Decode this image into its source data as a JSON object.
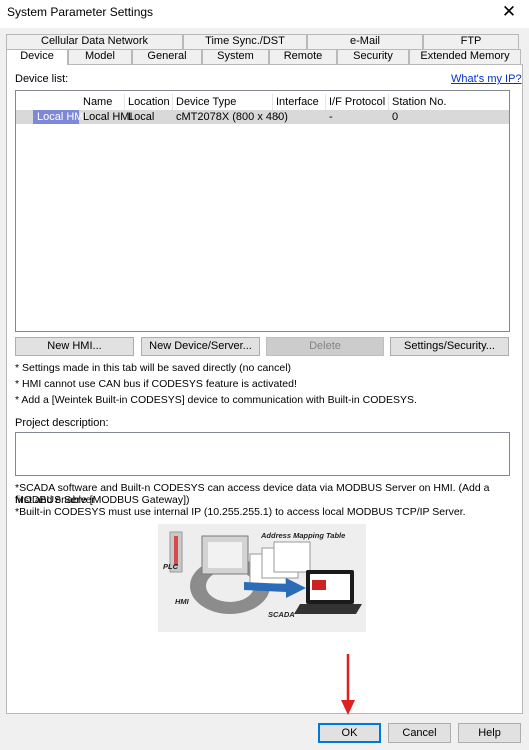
{
  "window": {
    "title": "System Parameter Settings",
    "close_glyph": "✕"
  },
  "tabs_row1": [
    "Cellular Data Network",
    "Time Sync./DST",
    "e-Mail",
    "FTP"
  ],
  "tabs_row2": [
    "Device",
    "Model",
    "General",
    "System",
    "Remote",
    "Security",
    "Extended Memory"
  ],
  "device_panel": {
    "list_label": "Device list:",
    "whats_my_ip": "What's my IP?",
    "columns": [
      "Name",
      "Location",
      "Device Type",
      "Interface",
      "I/F Protocol",
      "Station No."
    ],
    "rows": [
      {
        "tag": "Local HMI",
        "name": "Local HMI",
        "location": "Local",
        "device_type": "cMT2078X (800 x 480)",
        "interface": "-",
        "protocol": "-",
        "station": "0"
      }
    ],
    "buttons": {
      "new_hmi": "New HMI...",
      "new_device": "New Device/Server...",
      "delete": "Delete",
      "settings": "Settings/Security..."
    },
    "notes": [
      "* Settings made in this tab will be saved directly (no cancel)",
      "* HMI cannot use CAN bus if CODESYS feature is activated!",
      "* Add a [Weintek Built-in CODESYS] device to communication with Built-in CODESYS."
    ],
    "project_description_label": "Project description:",
    "info_lines": [
      "*SCADA software and Built-n CODESYS can access device data via MODBUS Server on HMI. (Add a MODBUS Server",
      "first and enable [MODBUS Gateway])",
      "*Built-in CODESYS must use internal IP (10.255.255.1) to access local MODBUS TCP/IP Server."
    ],
    "diagram": {
      "plc": "PLC",
      "hmi": "HMI",
      "scada": "SCADA",
      "mapping": "Address Mapping Table"
    }
  },
  "footer": {
    "ok": "OK",
    "cancel": "Cancel",
    "help": "Help"
  },
  "colors": {
    "selection": "#7e88d8",
    "link": "#0033cc",
    "arrow": "#e02020",
    "focus": "#0078d7"
  }
}
